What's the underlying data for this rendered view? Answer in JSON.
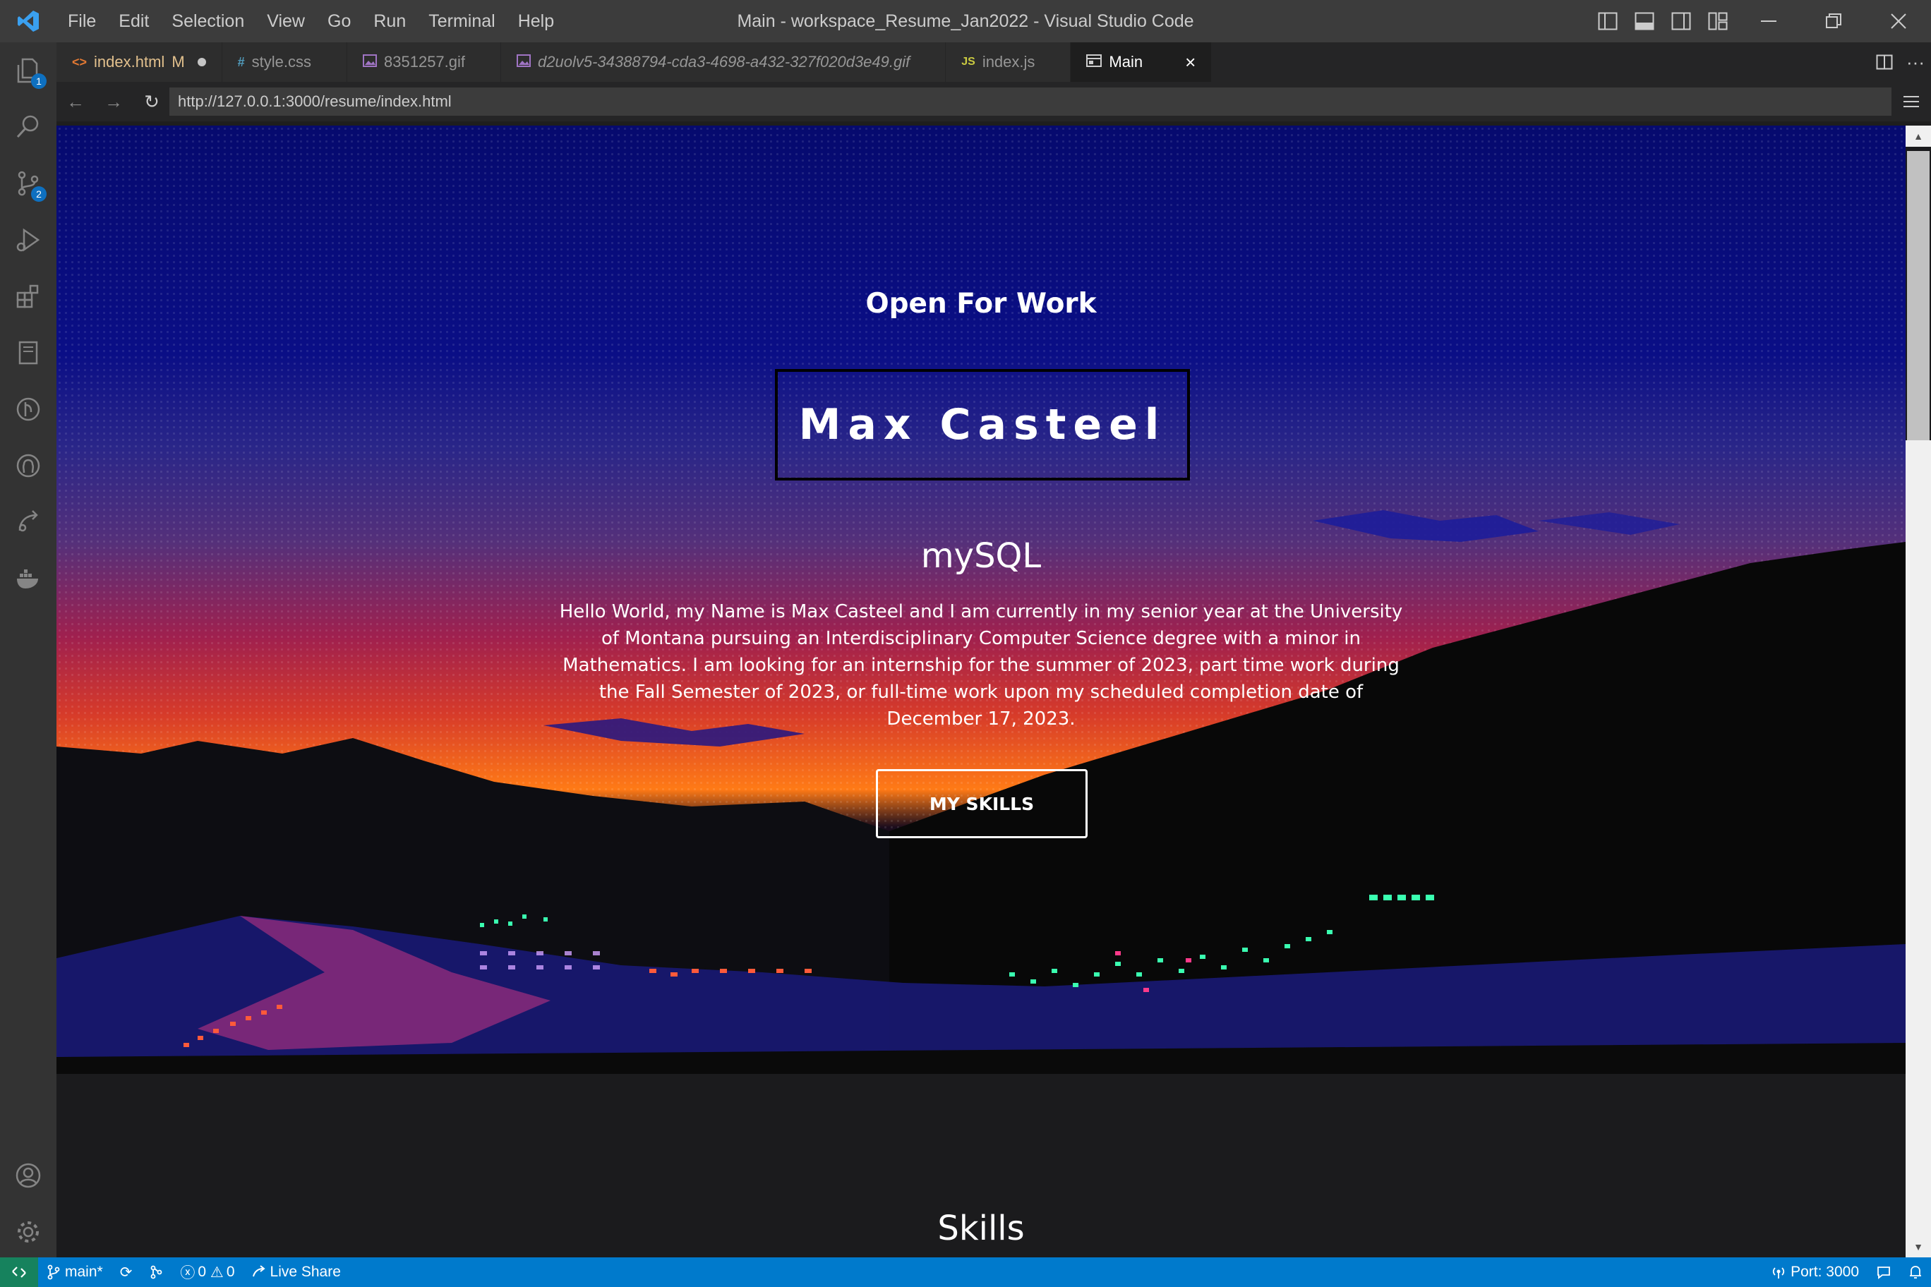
{
  "window": {
    "title": "Main - workspace_Resume_Jan2022 - Visual Studio Code",
    "menu": [
      "File",
      "Edit",
      "Selection",
      "View",
      "Go",
      "Run",
      "Terminal",
      "Help"
    ]
  },
  "activity_bar": {
    "explorer_badge": "1",
    "source_control_badge": "2"
  },
  "tabs": [
    {
      "label": "index.html",
      "marker": "M",
      "icon": "html-icon",
      "color": "#e37933",
      "modified": true
    },
    {
      "label": "style.css",
      "icon": "css-icon",
      "color": "#519aba"
    },
    {
      "label": "8351257.gif",
      "icon": "image-icon",
      "color": "#a074c4"
    },
    {
      "label": "d2uolv5-34388794-cda3-4698-a432-327f020d3e49.gif",
      "icon": "image-icon",
      "color": "#a074c4"
    },
    {
      "label": "index.js",
      "icon": "js-icon",
      "color": "#cbcb41"
    },
    {
      "label": "Main",
      "icon": "preview-icon",
      "active": true
    }
  ],
  "browser": {
    "url": "http://127.0.0.1:3000/resume/index.html"
  },
  "page": {
    "open_for_work": "Open For Work",
    "name": "Max Casteel",
    "rotating_word": "mySQL",
    "intro": "Hello World, my Name is Max Casteel and I am currently in my senior year at the University of Montana pursuing an Interdisciplinary Computer Science degree with a minor in Mathematics. I am looking for an internship for the summer of 2023, part time work during the Fall Semester of 2023, or full-time work upon my scheduled completion date of December 17, 2023.",
    "skills_button": "MY SKILLS",
    "skills_heading": "Skills"
  },
  "status_bar": {
    "branch": "main*",
    "errors": "0",
    "warnings": "0",
    "live_share": "Live Share",
    "port": "Port: 3000"
  },
  "colors": {
    "accent": "#007acc",
    "remote": "#16825d",
    "titlebar": "#3c3c3c"
  }
}
